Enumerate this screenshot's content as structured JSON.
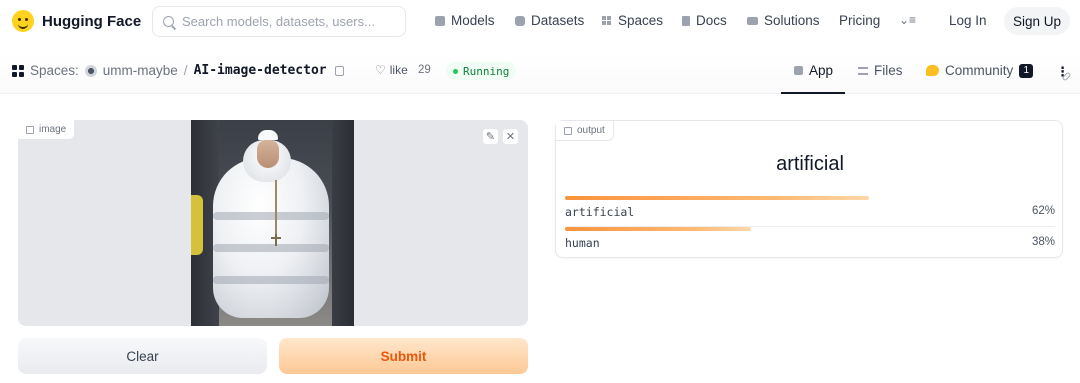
{
  "brand": {
    "name": "Hugging Face",
    "logo_icon": "hugging-face-emoji-icon",
    "logo_color": "#ffd21e"
  },
  "search": {
    "placeholder": "Search models, datasets, users...",
    "value": ""
  },
  "nav": {
    "items": [
      {
        "label": "Models",
        "icon": "cube-icon"
      },
      {
        "label": "Datasets",
        "icon": "database-icon"
      },
      {
        "label": "Spaces",
        "icon": "grid-icon"
      },
      {
        "label": "Docs",
        "icon": "book-icon"
      },
      {
        "label": "Solutions",
        "icon": "briefcase-icon"
      },
      {
        "label": "Pricing",
        "icon": ""
      }
    ],
    "more_icon": "more-menu-icon",
    "login": "Log In",
    "signup": "Sign Up"
  },
  "space": {
    "section": "Spaces:",
    "owner": "umm-maybe",
    "separator": "/",
    "repo": "AI-image-detector",
    "like_label": "like",
    "like_count": "29",
    "status": "Running",
    "status_color": "#22c55e",
    "tabs": [
      {
        "label": "App",
        "active": true
      },
      {
        "label": "Files",
        "active": false
      },
      {
        "label": "Community",
        "active": false,
        "badge": "1"
      }
    ]
  },
  "app": {
    "input": {
      "label": "image",
      "edit_icon": "pencil-icon",
      "close_icon": "close-icon"
    },
    "output": {
      "label": "output",
      "prediction": "artificial"
    },
    "confidences": [
      {
        "label": "artificial",
        "value": 0.62,
        "display": "62%"
      },
      {
        "label": "human",
        "value": 0.38,
        "display": "38%"
      }
    ],
    "buttons": {
      "clear": "Clear",
      "submit": "Submit"
    },
    "accent_color": "#ea580c"
  }
}
